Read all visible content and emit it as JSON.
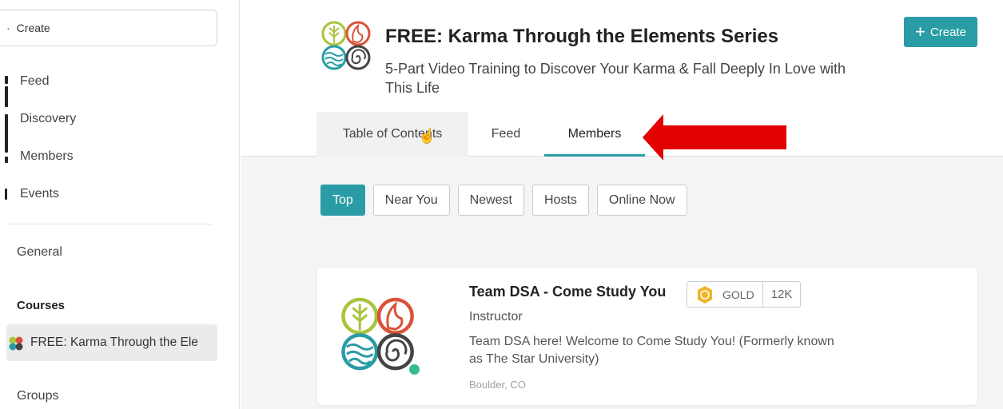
{
  "sidebar": {
    "create_label": "Create",
    "nav": [
      {
        "label": "Feed"
      },
      {
        "label": "Discovery"
      },
      {
        "label": "Members"
      },
      {
        "label": "Events"
      }
    ],
    "general_label": "General",
    "courses_heading": "Courses",
    "course_item_label": "FREE: Karma Through the Ele",
    "groups_label": "Groups"
  },
  "header": {
    "title": "FREE: Karma Through the Elements Series",
    "subtitle": "5-Part Video Training to Discover Your Karma & Fall Deeply In Love with This Life",
    "create_button": "Create",
    "tabs": [
      {
        "label": "Table of Contents"
      },
      {
        "label": "Feed"
      },
      {
        "label": "Members"
      }
    ]
  },
  "filters": [
    {
      "label": "Top",
      "active": true
    },
    {
      "label": "Near You"
    },
    {
      "label": "Newest"
    },
    {
      "label": "Hosts"
    },
    {
      "label": "Online Now"
    }
  ],
  "member_card": {
    "name": "Team DSA - Come Study You",
    "badge_level": "GOLD",
    "badge_count": "12K",
    "role": "Instructor",
    "bio": "Team DSA here! Welcome to Come Study You! (Formerly known as The Star University)",
    "location": "Boulder, CO"
  },
  "colors": {
    "accent": "#2a9ca5",
    "annotation_arrow": "#e30000",
    "online_dot": "#34c08a",
    "gold": "#f0b429"
  }
}
